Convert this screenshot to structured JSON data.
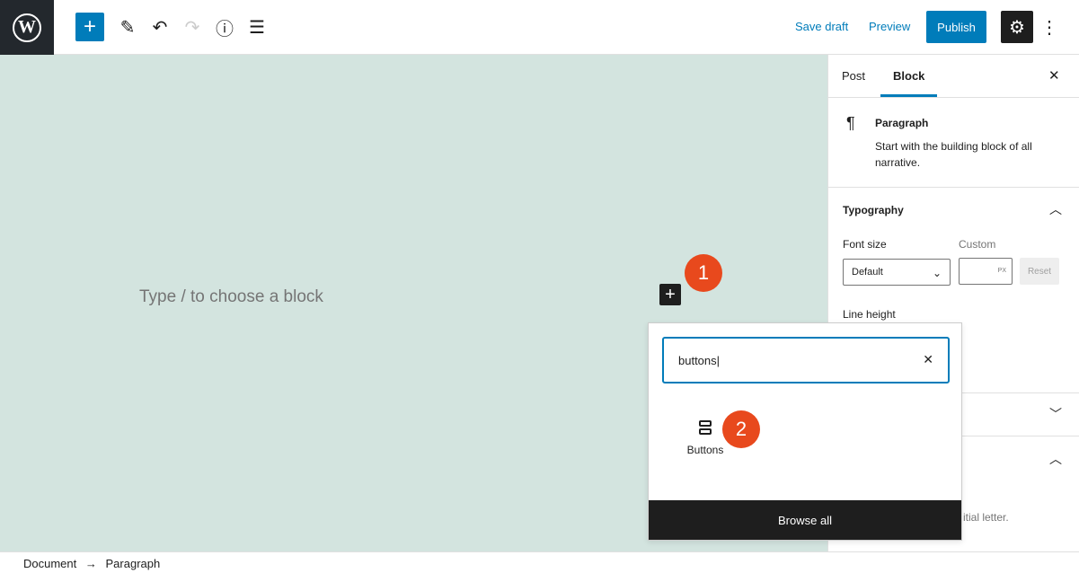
{
  "toolbar": {
    "logo": "W",
    "add": "+",
    "edit": "✎",
    "undo": "↶",
    "redo": "↷",
    "info": "ⓘ",
    "list": "☰",
    "save_draft": "Save draft",
    "preview": "Preview",
    "publish": "Publish",
    "settings": "⚙",
    "more": "⋮"
  },
  "canvas": {
    "placeholder": "Type / to choose a block",
    "inline_add": "+"
  },
  "badges": [
    "1",
    "2"
  ],
  "sidebar": {
    "tabs": [
      "Post",
      "Block"
    ],
    "close": "✕",
    "block": {
      "icon": "¶",
      "name": "Paragraph",
      "description": "Start with the building block of all narrative."
    },
    "typography": {
      "title": "Typography",
      "font_size_label": "Font size",
      "font_size_value": "Default",
      "custom_label": "Custom",
      "unit": "PX",
      "reset": "Reset",
      "line_height": "Line height"
    },
    "partial_text": "itial letter."
  },
  "inserter": {
    "search_value": "buttons",
    "clear": "✕",
    "result_label": "Buttons",
    "browse_all": "Browse all"
  },
  "breadcrumb": {
    "items": [
      "Document",
      "Paragraph"
    ],
    "separator": "→"
  },
  "colors": {
    "accent": "#007cba",
    "badge": "#e8491d",
    "canvas": "#d3e4df"
  }
}
